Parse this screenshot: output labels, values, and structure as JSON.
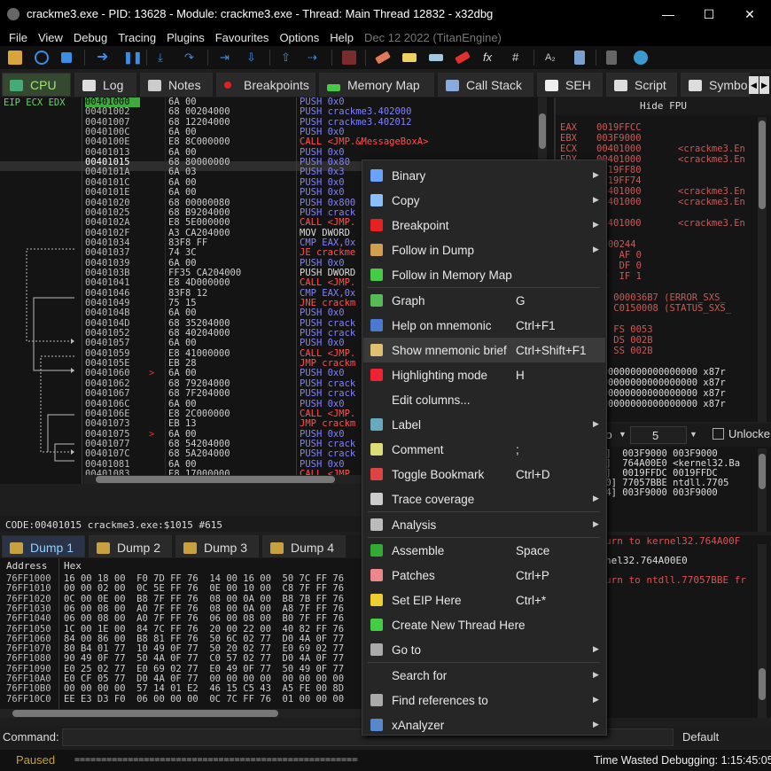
{
  "window": {
    "title": "crackme3.exe - PID: 13628 - Module: crackme3.exe - Thread: Main Thread 12832 - x32dbg",
    "minimize": "—",
    "maximize": "☐",
    "close": "✕"
  },
  "menu": [
    "File",
    "View",
    "Debug",
    "Tracing",
    "Plugins",
    "Favourites",
    "Options",
    "Help"
  ],
  "menu_date": "Dec 12 2022 (TitanEngine)",
  "tabs": [
    {
      "label": "CPU",
      "icon": "cpu-icon",
      "color": "#4a7"
    },
    {
      "label": "Log",
      "icon": "log-icon",
      "color": "#ddd"
    },
    {
      "label": "Notes",
      "icon": "notes-icon",
      "color": "#ccc"
    },
    {
      "label": "Breakpoints",
      "icon": "breakpoint-icon",
      "color": "#e02020"
    },
    {
      "label": "Memory Map",
      "icon": "memory-map-icon",
      "color": "#4c4"
    },
    {
      "label": "Call Stack",
      "icon": "call-stack-icon",
      "color": "#8ad"
    },
    {
      "label": "SEH",
      "icon": "seh-icon",
      "color": "#eee"
    },
    {
      "label": "Script",
      "icon": "script-icon",
      "color": "#ddd"
    },
    {
      "label": "Symbo",
      "icon": "symbols-icon",
      "color": "#ddd"
    }
  ],
  "reg_header": "EIP ECX EDX",
  "disasm": [
    {
      "addr": "00401000",
      "bytes": "6A 00",
      "instr": "PUSH 0x0",
      "c": "#8080ff"
    },
    {
      "addr": "00401002",
      "bytes": "68 00204000",
      "instr": "PUSH crackme3.402000",
      "c": "#8080ff"
    },
    {
      "addr": "00401007",
      "bytes": "68 12204000",
      "instr": "PUSH crackme3.402012",
      "c": "#8080ff"
    },
    {
      "addr": "0040100C",
      "bytes": "6A 00",
      "instr": "PUSH 0x0",
      "c": "#8080ff"
    },
    {
      "addr": "0040100E",
      "bytes": "E8 8C000000",
      "instr": "CALL <JMP.&MessageBoxA>",
      "c": "#ff5050"
    },
    {
      "addr": "00401013",
      "bytes": "6A 00",
      "instr": "PUSH 0x0",
      "c": "#8080ff"
    },
    {
      "addr": "00401015",
      "bytes": "68 80000000",
      "instr": "PUSH 0x80",
      "c": "#8080ff"
    },
    {
      "addr": "0040101A",
      "bytes": "6A 03",
      "instr": "PUSH 0x3",
      "c": "#8080ff"
    },
    {
      "addr": "0040101C",
      "bytes": "6A 00",
      "instr": "PUSH 0x0",
      "c": "#8080ff"
    },
    {
      "addr": "0040101E",
      "bytes": "6A 00",
      "instr": "PUSH 0x0",
      "c": "#8080ff"
    },
    {
      "addr": "00401020",
      "bytes": "68 00000080",
      "instr": "PUSH 0x800",
      "c": "#8080ff"
    },
    {
      "addr": "00401025",
      "bytes": "68 B9204000",
      "instr": "PUSH crack",
      "c": "#8080ff"
    },
    {
      "addr": "0040102A",
      "bytes": "E8 5E000000",
      "instr": "CALL <JMP.",
      "c": "#ff5050"
    },
    {
      "addr": "0040102F",
      "bytes": "A3 CA204000",
      "instr": "MOV DWORD",
      "c": "#dddddd"
    },
    {
      "addr": "00401034",
      "bytes": "83F8 FF",
      "instr": "CMP EAX,0x",
      "c": "#8080ff"
    },
    {
      "addr": "00401037",
      "bytes": "74 3C",
      "instr": "JE crackme",
      "c": "#ff5050"
    },
    {
      "addr": "00401039",
      "bytes": "6A 00",
      "instr": "PUSH 0x0",
      "c": "#8080ff"
    },
    {
      "addr": "0040103B",
      "bytes": "FF35 CA204000",
      "instr": "PUSH DWORD",
      "c": "#dddddd"
    },
    {
      "addr": "00401041",
      "bytes": "E8 4D000000",
      "instr": "CALL <JMP.",
      "c": "#ff5050"
    },
    {
      "addr": "00401046",
      "bytes": "83F8 12",
      "instr": "CMP EAX,0x",
      "c": "#8080ff"
    },
    {
      "addr": "00401049",
      "bytes": "75 15",
      "instr": "JNE crackm",
      "c": "#ff5050"
    },
    {
      "addr": "0040104B",
      "bytes": "6A 00",
      "instr": "PUSH 0x0",
      "c": "#8080ff"
    },
    {
      "addr": "0040104D",
      "bytes": "68 35204000",
      "instr": "PUSH crack",
      "c": "#8080ff"
    },
    {
      "addr": "00401052",
      "bytes": "68 40204000",
      "instr": "PUSH crack",
      "c": "#8080ff"
    },
    {
      "addr": "00401057",
      "bytes": "6A 00",
      "instr": "PUSH 0x0",
      "c": "#8080ff"
    },
    {
      "addr": "00401059",
      "bytes": "E8 41000000",
      "instr": "CALL <JMP.",
      "c": "#ff5050"
    },
    {
      "addr": "0040105E",
      "bytes": "EB 28",
      "instr": "JMP crackm",
      "c": "#ff5050"
    },
    {
      "addr": "00401060",
      "bytes": "6A 00",
      "instr": "PUSH 0x0",
      "c": "#8080ff"
    },
    {
      "addr": "00401062",
      "bytes": "68 79204000",
      "instr": "PUSH crack",
      "c": "#8080ff"
    },
    {
      "addr": "00401067",
      "bytes": "68 7F204000",
      "instr": "PUSH crack",
      "c": "#8080ff"
    },
    {
      "addr": "0040106C",
      "bytes": "6A 00",
      "instr": "PUSH 0x0",
      "c": "#8080ff"
    },
    {
      "addr": "0040106E",
      "bytes": "E8 2C000000",
      "instr": "CALL <JMP.",
      "c": "#ff5050"
    },
    {
      "addr": "00401073",
      "bytes": "EB 13",
      "instr": "JMP crackm",
      "c": "#ff5050"
    },
    {
      "addr": "00401075",
      "bytes": "6A 00",
      "instr": "PUSH 0x0",
      "c": "#8080ff"
    },
    {
      "addr": "00401077",
      "bytes": "68 54204000",
      "instr": "PUSH crack",
      "c": "#8080ff"
    },
    {
      "addr": "0040107C",
      "bytes": "68 5A204000",
      "instr": "PUSH crack",
      "c": "#8080ff"
    },
    {
      "addr": "00401081",
      "bytes": "6A 00",
      "instr": "PUSH 0x0",
      "c": "#8080ff"
    },
    {
      "addr": "00401083",
      "bytes": "E8 17000000",
      "instr": "CALL <JMP.",
      "c": "#ff5050"
    }
  ],
  "code_info": "CODE:00401015 crackme3.exe:$1015 #615",
  "hide_fpu": "Hide FPU",
  "registers": [
    {
      "n": "EAX",
      "v": "0019FFCC",
      "x": ""
    },
    {
      "n": "EBX",
      "v": "003F9000",
      "x": ""
    },
    {
      "n": "ECX",
      "v": "00401000",
      "x": "<crackme3.En"
    },
    {
      "n": "EDX",
      "v": "00401000",
      "x": "<crackme3.En"
    },
    {
      "n": "",
      "v": "0019FF80",
      "x": ""
    },
    {
      "n": "",
      "v": "0019FF74",
      "x": ""
    },
    {
      "n": "",
      "v": "00401000",
      "x": "<crackme3.En"
    },
    {
      "n": "",
      "v": "00401000",
      "x": "<crackme3.En"
    },
    {
      "n": "",
      "v": "",
      "x": ""
    },
    {
      "n": "",
      "v": "00401000",
      "x": "<crackme3.En"
    }
  ],
  "reg_lower": [
    "00000244",
    "F 1  AF 0",
    "F 0  DF 0",
    "F 0  IF 1",
    "",
    "or  000036B7 (ERROR_SXS_",
    "cus C0150008 (STATUS_SXS_",
    "",
    "    FS 0053",
    "    DS 002B",
    "    SS 002B",
    "",
    "0000000000000000000 x87r",
    "0000000000000000000 x87r",
    "0000000000000000000 x87r",
    "0000000000000000000 x87r"
  ],
  "stack_ctrl": {
    "mode": "ito",
    "value": "5",
    "unlock": "Unlocke"
  },
  "stack_rows": [
    "4]  003F9000 003F9000",
    "8]  764A00E0 <kernel32.Ba",
    "C]  0019FFDC 0019FFDC",
    "10] 77057BBE ntdll.7705",
    "14] 003F9000 003F9000"
  ],
  "dump_tabs": [
    "Dump 1",
    "Dump 2",
    "Dump 3",
    "Dump 4"
  ],
  "dump_header": {
    "address": "Address",
    "hex": "Hex"
  },
  "dump": [
    {
      "a": "76FF1000",
      "h": "16 00 18 00  F0 7D FF 76  14 00 16 00  50 7C FF 76"
    },
    {
      "a": "76FF1010",
      "h": "00 00 02 00  0C 5E FF 76  0E 00 10 00  C8 7F FF 76"
    },
    {
      "a": "76FF1020",
      "h": "0C 00 0E 00  B8 7F FF 76  08 00 0A 00  B8 7B FF 76"
    },
    {
      "a": "76FF1030",
      "h": "06 00 08 00  A0 7F FF 76  08 00 0A 00  A8 7F FF 76"
    },
    {
      "a": "76FF1040",
      "h": "06 00 08 00  A0 7F FF 76  06 00 08 00  B0 7F FF 76"
    },
    {
      "a": "76FF1050",
      "h": "1C 00 1E 00  84 7C FF 76  20 00 22 00  40 82 FF 76"
    },
    {
      "a": "76FF1060",
      "h": "84 00 86 00  B8 81 FF 76  50 6C 02 77  D0 4A 0F 77"
    },
    {
      "a": "76FF1070",
      "h": "80 B4 01 77  10 49 0F 77  50 20 02 77  E0 69 02 77"
    },
    {
      "a": "76FF1080",
      "h": "90 49 0F 77  50 4A 0F 77  C0 57 02 77  D0 4A 0F 77"
    },
    {
      "a": "76FF1090",
      "h": "E0 25 02 77  E0 69 02 77  E0 49 0F 77  50 49 0F 77"
    },
    {
      "a": "76FF10A0",
      "h": "E0 CF 05 77  D0 4A 0F 77  00 00 00 00  00 00 00 00"
    },
    {
      "a": "76FF10B0",
      "h": "00 00 00 00  57 14 01 E2  46 15 C5 43  A5 FE 00 8D"
    },
    {
      "a": "76FF10C0",
      "h": "EE E3 D3 F0  06 00 00 00  0C 7C FF 76  01 00 00 00"
    }
  ],
  "log_right": [
    "urn to kernel32.764A00F",
    "nel32.764A00E0",
    "urn to ntdll.77057BBE fr"
  ],
  "command_label": "Command:",
  "command_value": "",
  "command_mode": "Default",
  "status": {
    "state": "Paused",
    "progress": "===========================================================",
    "time": "Time Wasted Debugging: 1:15:45:05"
  },
  "context_menu": [
    {
      "label": "Binary",
      "shortcut": "",
      "sub": true,
      "icon": "binary-icon",
      "ic": "#6aa3ff"
    },
    {
      "label": "Copy",
      "shortcut": "",
      "sub": true,
      "icon": "copy-icon",
      "ic": "#8ac0ff"
    },
    {
      "label": "Breakpoint",
      "shortcut": "",
      "sub": true,
      "icon": "breakpoint-icon",
      "ic": "#e82020"
    },
    {
      "label": "Follow in Dump",
      "shortcut": "",
      "sub": true,
      "icon": "follow-dump-icon",
      "ic": "#d0a050"
    },
    {
      "label": "Follow in Memory Map",
      "shortcut": "",
      "sub": false,
      "icon": "memory-map-icon",
      "ic": "#4c4"
    },
    {
      "label": "Graph",
      "shortcut": "G",
      "sub": false,
      "icon": "graph-icon",
      "ic": "#5b5"
    },
    {
      "label": "Help on mnemonic",
      "shortcut": "Ctrl+F1",
      "sub": false,
      "icon": "help-icon",
      "ic": "#4a7ad0"
    },
    {
      "label": "Show mnemonic brief",
      "shortcut": "Ctrl+Shift+F1",
      "sub": false,
      "icon": "mnemonic-brief-icon",
      "ic": "#e0c070"
    },
    {
      "label": "Highlighting mode",
      "shortcut": "H",
      "sub": false,
      "icon": "highlight-icon",
      "ic": "#e23"
    },
    {
      "label": "Edit columns...",
      "shortcut": "",
      "sub": false,
      "icon": "",
      "ic": ""
    },
    {
      "label": "Label",
      "shortcut": "",
      "sub": true,
      "icon": "label-icon",
      "ic": "#6ab"
    },
    {
      "label": "Comment",
      "shortcut": ";",
      "sub": false,
      "icon": "comment-icon",
      "ic": "#dd7"
    },
    {
      "label": "Toggle Bookmark",
      "shortcut": "Ctrl+D",
      "sub": false,
      "icon": "bookmark-icon",
      "ic": "#d44"
    },
    {
      "label": "Trace coverage",
      "shortcut": "",
      "sub": true,
      "icon": "trace-icon",
      "ic": "#ccc"
    },
    {
      "label": "Analysis",
      "shortcut": "",
      "sub": true,
      "icon": "analysis-icon",
      "ic": "#bbb"
    },
    {
      "label": "Assemble",
      "shortcut": "Space",
      "sub": false,
      "icon": "assemble-icon",
      "ic": "#3a3"
    },
    {
      "label": "Patches",
      "shortcut": "Ctrl+P",
      "sub": false,
      "icon": "patches-icon",
      "ic": "#e88"
    },
    {
      "label": "Set EIP Here",
      "shortcut": "Ctrl+*",
      "sub": false,
      "icon": "set-eip-icon",
      "ic": "#ec3"
    },
    {
      "label": "Create New Thread Here",
      "shortcut": "",
      "sub": false,
      "icon": "new-thread-icon",
      "ic": "#4c4"
    },
    {
      "label": "Go to",
      "shortcut": "",
      "sub": true,
      "icon": "goto-icon",
      "ic": "#aaa"
    },
    {
      "label": "Search for",
      "shortcut": "",
      "sub": true,
      "icon": "",
      "ic": ""
    },
    {
      "label": "Find references to",
      "shortcut": "",
      "sub": true,
      "icon": "find-refs-icon",
      "ic": "#aaa"
    },
    {
      "label": "xAnalyzer",
      "shortcut": "",
      "sub": true,
      "icon": "xanalyzer-icon",
      "ic": "#58c"
    }
  ]
}
